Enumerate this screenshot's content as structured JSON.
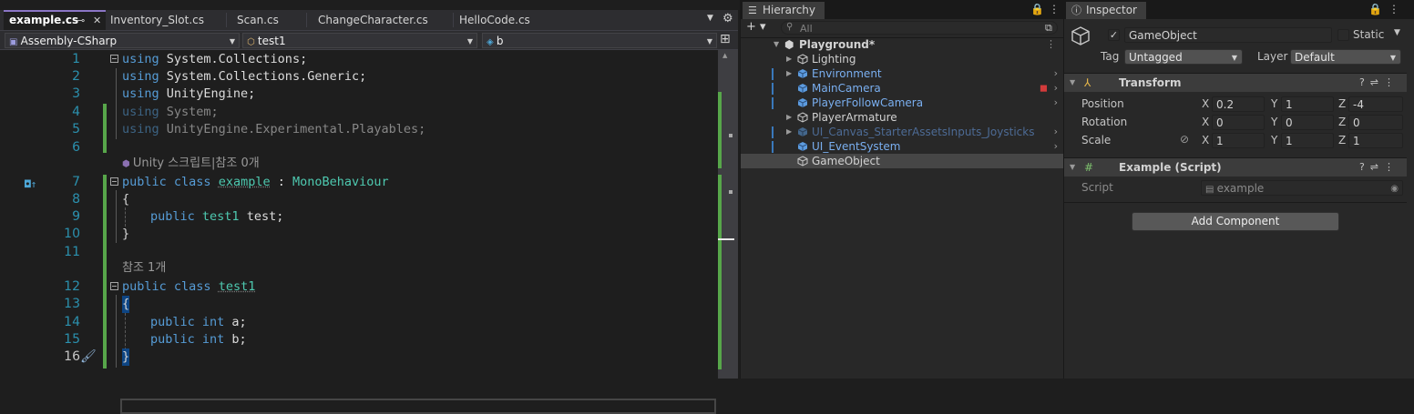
{
  "editor": {
    "tabs": [
      {
        "label": "example.cs",
        "active": true
      },
      {
        "label": "Inventory_Slot.cs"
      },
      {
        "label": "Scan.cs"
      },
      {
        "label": "ChangeCharacter.cs"
      },
      {
        "label": "HelloCode.cs"
      }
    ],
    "tab_pin_icon": "⊸",
    "tab_close_icon": "✕",
    "nav": {
      "project": "Assembly-CSharp",
      "type": "test1",
      "member": "b"
    },
    "code_lens": {
      "unity_script": "Unity 스크립트|참조 0개",
      "refs_class": "참조 1개"
    },
    "code": {
      "l1_kw": "using",
      "l1_rest": " System.Collections;",
      "l2_kw": "using",
      "l2_rest": " System.Collections.Generic;",
      "l3_kw": "using",
      "l3_rest": " UnityEngine;",
      "l4_kw": "using",
      "l4_rest": " System;",
      "l5_kw": "using",
      "l5_rest": " UnityEngine.Experimental.Playables;",
      "l7_kw": "public class",
      "l7_name": "example",
      "l7_colon": " : ",
      "l7_base": "MonoBehaviour",
      "l8": "{",
      "l9_kw": "public",
      "l9_type": "test1",
      "l9_rest": " test;",
      "l10": "}",
      "l12_kw": "public class",
      "l12_name": "test1",
      "l13": "{",
      "l14_kw": "public int",
      "l14_rest": " a;",
      "l15_kw": "public int",
      "l15_rest": " b;",
      "l16": "}"
    },
    "line_numbers": [
      "1",
      "2",
      "3",
      "4",
      "5",
      "6",
      "7",
      "8",
      "9",
      "10",
      "11",
      "12",
      "13",
      "14",
      "15",
      "16"
    ]
  },
  "hierarchy": {
    "tab_label": "Hierarchy",
    "search_placeholder": "All",
    "add_label": "+ ▾",
    "scene": "Playground*",
    "items": [
      {
        "label": "Lighting",
        "kind": "plain"
      },
      {
        "label": "Environment",
        "kind": "prefab"
      },
      {
        "label": "MainCamera",
        "kind": "prefab"
      },
      {
        "label": "PlayerFollowCamera",
        "kind": "prefab"
      },
      {
        "label": "PlayerArmature",
        "kind": "plain"
      },
      {
        "label": "UI_Canvas_StarterAssetsInputs_Joysticks",
        "kind": "prefab-dim"
      },
      {
        "label": "UI_EventSystem",
        "kind": "prefab"
      },
      {
        "label": "GameObject",
        "kind": "plain",
        "selected": true
      }
    ]
  },
  "inspector": {
    "tab_label": "Inspector",
    "object_name": "GameObject",
    "active": true,
    "static_label": "Static",
    "tag_label": "Tag",
    "tag_value": "Untagged",
    "layer_label": "Layer",
    "layer_value": "Default",
    "transform": {
      "title": "Transform",
      "position_label": "Position",
      "position": {
        "x": "0.2",
        "y": "1",
        "z": "-4"
      },
      "rotation_label": "Rotation",
      "rotation": {
        "x": "0",
        "y": "0",
        "z": "0"
      },
      "scale_label": "Scale",
      "scale": {
        "x": "1",
        "y": "1",
        "z": "1"
      },
      "axis_x": "X",
      "axis_y": "Y",
      "axis_z": "Z"
    },
    "script_component": {
      "title": "Example (Script)",
      "script_label": "Script",
      "script_value": "example"
    },
    "add_component_label": "Add Component"
  },
  "colors": {
    "accent_purple": "#8b75c5",
    "change_bar": "#57a64a",
    "prefab_blue": "#7aaff0"
  }
}
